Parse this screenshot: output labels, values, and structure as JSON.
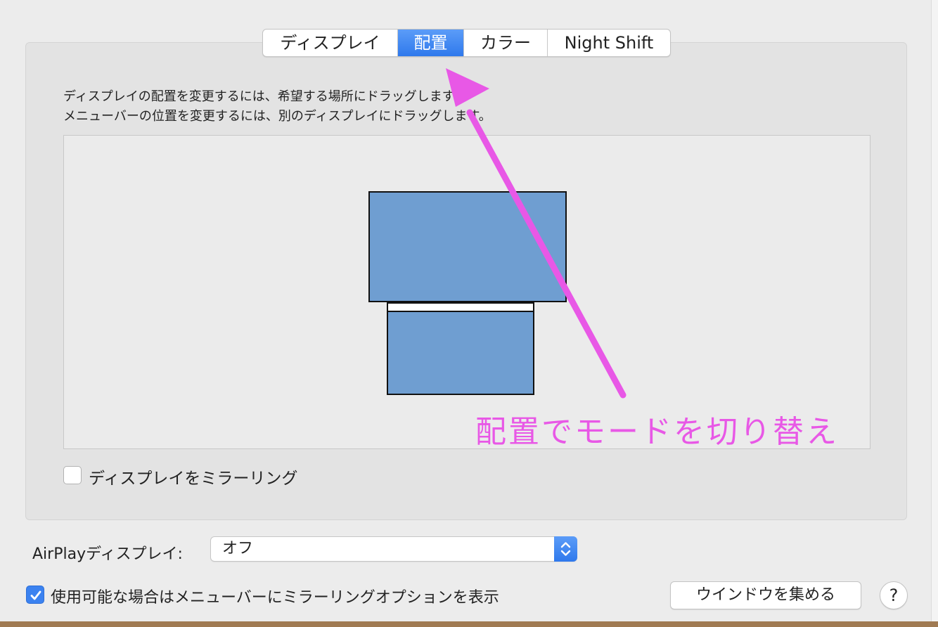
{
  "tabs": [
    {
      "label": "ディスプレイ",
      "selected": false
    },
    {
      "label": "配置",
      "selected": true
    },
    {
      "label": "カラー",
      "selected": false
    },
    {
      "label": "Night Shift",
      "selected": false
    }
  ],
  "instructions": {
    "line1": "ディスプレイの配置を変更するには、希望する場所にドラッグします。",
    "line2": "メニューバーの位置を変更するには、別のディスプレイにドラッグします。"
  },
  "mirror": {
    "label": "ディスプレイをミラーリング",
    "checked": false
  },
  "airplay": {
    "label": "AirPlayディスプレイ:",
    "value": "オフ"
  },
  "show_mirror_options": {
    "label": "使用可能な場合はメニューバーにミラーリングオプションを表示",
    "checked": true
  },
  "gather_windows_label": "ウインドウを集める",
  "help_label": "?",
  "annotation": {
    "text": "配置でモードを切り替え",
    "color": "#e858e6"
  },
  "colors": {
    "accent": "#3b82f0",
    "display_fill": "#6f9ed1"
  }
}
